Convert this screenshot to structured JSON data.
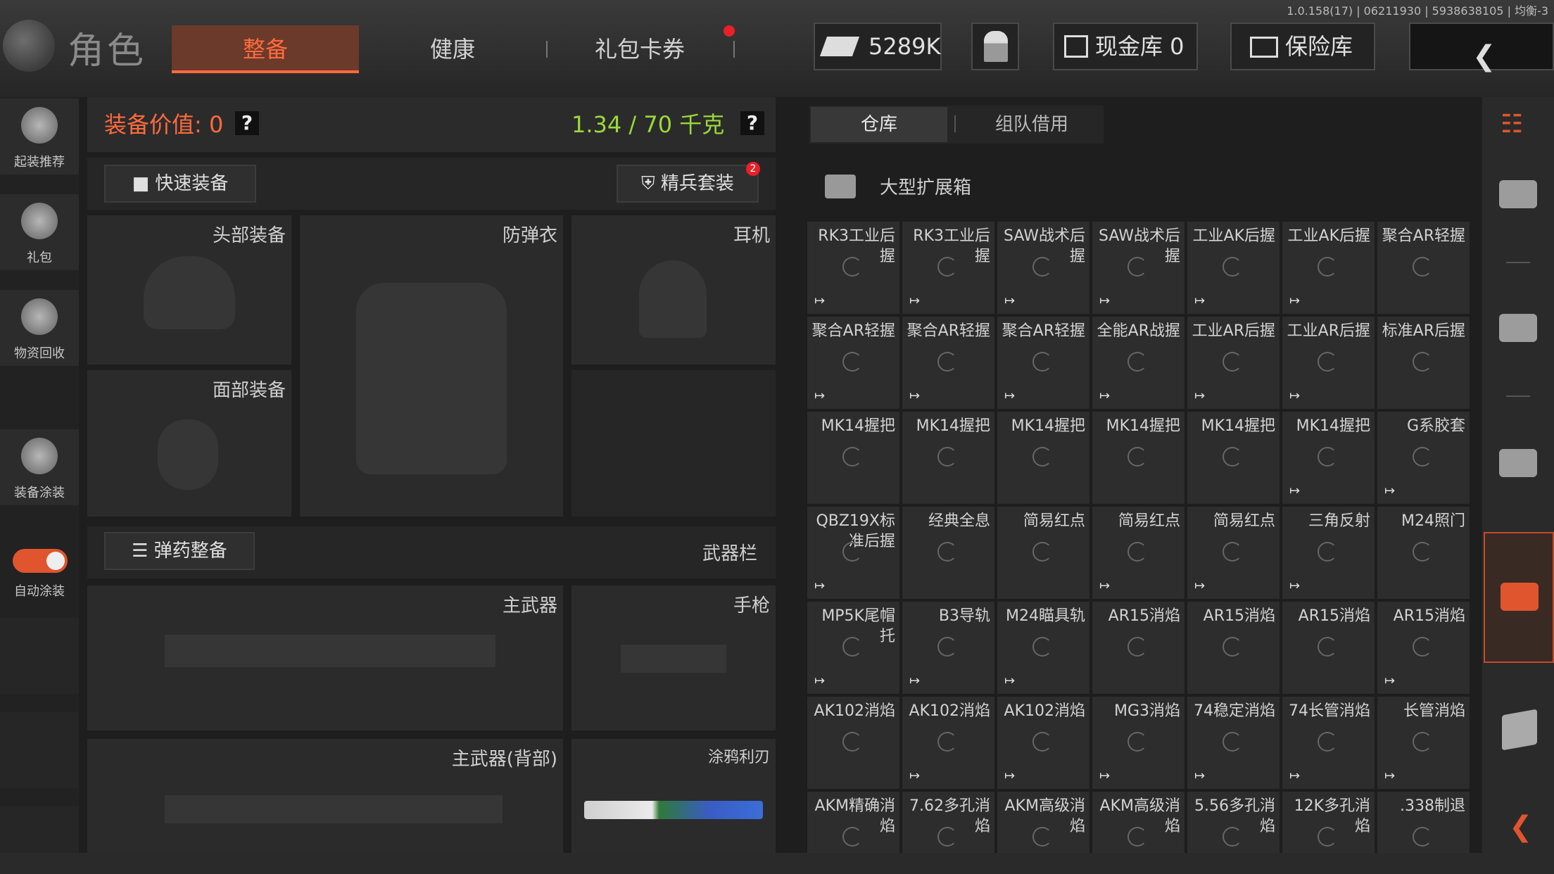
{
  "version": "1.0.158(17) | 06211930 | 5938638105 | 均衡-3",
  "page_title": "角色",
  "tabs": [
    {
      "label": "整备",
      "active": true
    },
    {
      "label": "健康",
      "active": false
    },
    {
      "label": "礼包卡券",
      "active": false
    }
  ],
  "currency": {
    "money": "5289K",
    "cash_vault": "现金库 0",
    "safe": "保险库"
  },
  "sidebar": [
    {
      "label": "起装推荐"
    },
    {
      "label": "礼包"
    },
    {
      "label": "物资回收"
    },
    {
      "label": "装备涂装"
    },
    {
      "label": "自动涂装"
    }
  ],
  "equipment": {
    "value_label": "装备价值: 0",
    "weight": "1.34 / 70 千克",
    "help": "?",
    "quick_equip": "快速装备",
    "elite_kit": "精兵套装",
    "elite_badge": "2",
    "slots": {
      "head": "头部装备",
      "armor": "防弹衣",
      "headset": "耳机",
      "face": "面部装备",
      "primary": "主武器",
      "pistol": "手枪",
      "primary_back": "主武器(背部)",
      "melee": "涂鸦利刃"
    },
    "ammo_button": "弹药整备",
    "weapon_bar": "武器栏"
  },
  "warehouse": {
    "tabs": [
      "仓库",
      "组队借用"
    ],
    "container": "大型扩展箱",
    "items": [
      [
        "RK3工业后握",
        "RK3工业后握",
        "SAW战术后握",
        "SAW战术后握",
        "工业AK后握",
        "工业AK后握",
        "聚合AR轻握"
      ],
      [
        "聚合AR轻握",
        "聚合AR轻握",
        "聚合AR轻握",
        "全能AR战握",
        "工业AR后握",
        "工业AR后握",
        "标准AR后握"
      ],
      [
        "MK14握把",
        "MK14握把",
        "MK14握把",
        "MK14握把",
        "MK14握把",
        "MK14握把",
        "G系胶套"
      ],
      [
        "QBZ19X标准后握",
        "经典全息",
        "简易红点",
        "简易红点",
        "简易红点",
        "三角反射",
        "M24照门"
      ],
      [
        "MP5K尾帽托",
        "B3导轨",
        "M24瞄具轨",
        "AR15消焰",
        "AR15消焰",
        "AR15消焰",
        "AR15消焰"
      ],
      [
        "AK102消焰",
        "AK102消焰",
        "AK102消焰",
        "MG3消焰",
        "74稳定消焰",
        "74长管消焰",
        "长管消焰"
      ],
      [
        "AKM精确消焰",
        "7.62多孔消焰",
        "AKM高级消焰",
        "AKM高级消焰",
        "5.56多孔消焰",
        "12K多孔消焰",
        ".338制退"
      ]
    ],
    "mark_glyph": "↦",
    "marked": [
      [
        true,
        true,
        true,
        true,
        true,
        true,
        false
      ],
      [
        true,
        true,
        true,
        true,
        true,
        true,
        false
      ],
      [
        false,
        false,
        false,
        false,
        false,
        true,
        true
      ],
      [
        true,
        false,
        false,
        true,
        true,
        true,
        false
      ],
      [
        true,
        true,
        true,
        false,
        false,
        false,
        true
      ],
      [
        false,
        true,
        true,
        true,
        true,
        true,
        true
      ],
      [
        false,
        false,
        false,
        false,
        false,
        false,
        false
      ]
    ]
  },
  "colors": {
    "accent": "#ff6a3d",
    "weight": "#9bd83a",
    "badge": "#e8202a"
  }
}
